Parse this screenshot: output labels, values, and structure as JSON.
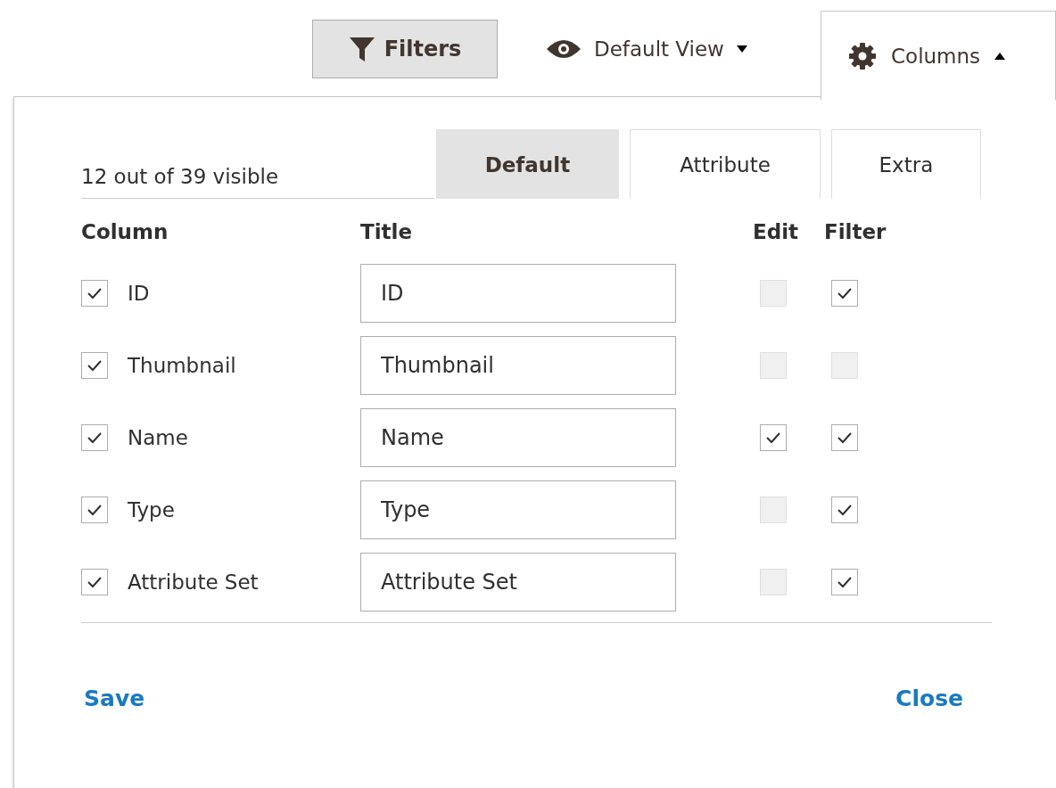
{
  "toolbar": {
    "filters": "Filters",
    "view": "Default View",
    "columns": "Columns",
    "columns_expanded": true
  },
  "panel": {
    "visible_count": "12 out of 39 visible",
    "tabs": [
      {
        "label": "Default",
        "selected": true
      },
      {
        "label": "Attribute",
        "selected": false
      },
      {
        "label": "Extra",
        "selected": false
      }
    ],
    "headers": {
      "column": "Column",
      "title": "Title",
      "edit": "Edit",
      "filter": "Filter"
    },
    "rows": [
      {
        "column": "ID",
        "checked": true,
        "title": "ID",
        "edit": {
          "checked": false,
          "disabled": true
        },
        "filter": {
          "checked": true,
          "disabled": false
        }
      },
      {
        "column": "Thumbnail",
        "checked": true,
        "title": "Thumbnail",
        "edit": {
          "checked": false,
          "disabled": true
        },
        "filter": {
          "checked": false,
          "disabled": true
        }
      },
      {
        "column": "Name",
        "checked": true,
        "title": "Name",
        "edit": {
          "checked": true,
          "disabled": false
        },
        "filter": {
          "checked": true,
          "disabled": false
        }
      },
      {
        "column": "Type",
        "checked": true,
        "title": "Type",
        "edit": {
          "checked": false,
          "disabled": true
        },
        "filter": {
          "checked": true,
          "disabled": false
        }
      },
      {
        "column": "Attribute Set",
        "checked": true,
        "title": "Attribute Set",
        "edit": {
          "checked": false,
          "disabled": true
        },
        "filter": {
          "checked": true,
          "disabled": false
        }
      }
    ],
    "save": "Save",
    "close": "Close"
  }
}
